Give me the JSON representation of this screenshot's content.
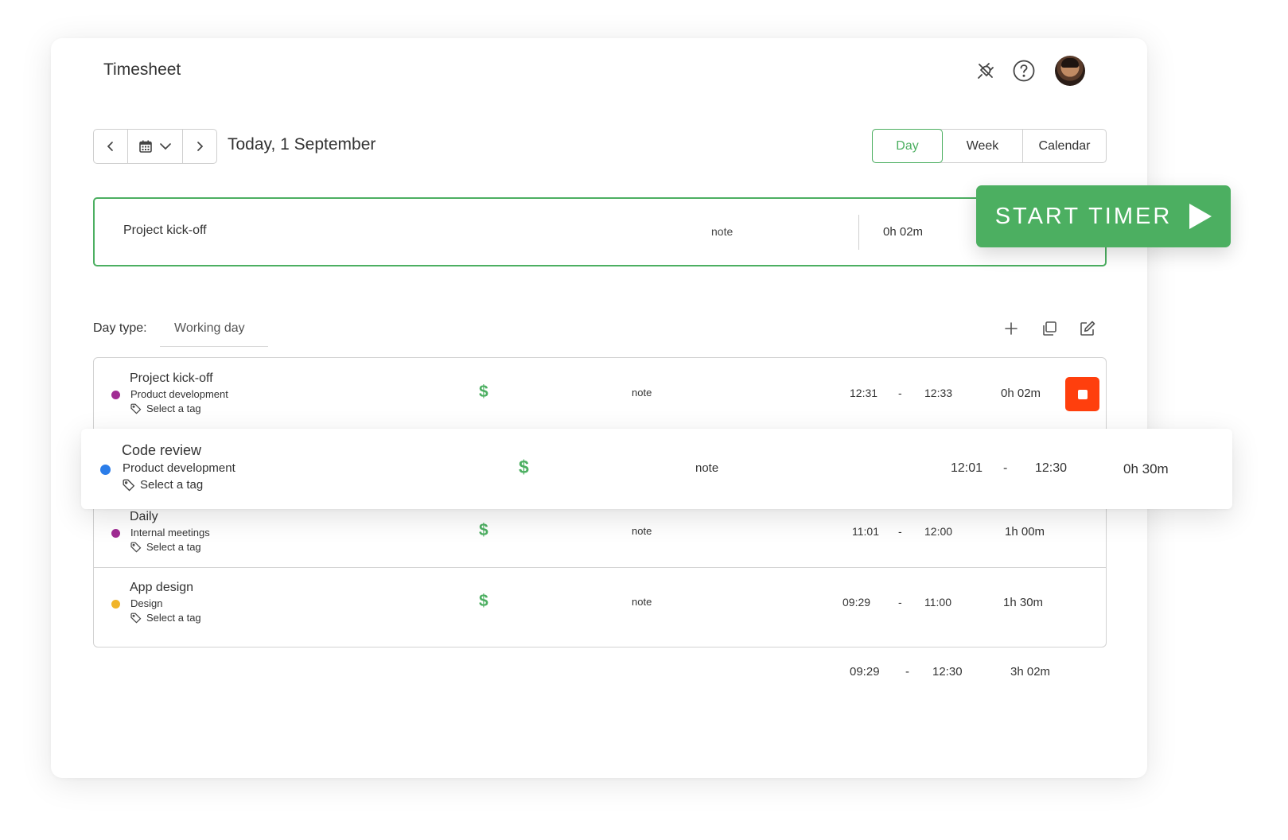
{
  "header": {
    "title": "Timesheet"
  },
  "icons": {
    "integrations": "plug-icon",
    "help": "help-circle-icon",
    "avatar": "user-avatar"
  },
  "date_nav": {
    "date_label": "Today, 1 September"
  },
  "view_tabs": {
    "day": "Day",
    "week": "Week",
    "calendar": "Calendar",
    "active": "Day"
  },
  "timer": {
    "task": "Project kick-off",
    "note": "note",
    "duration": "0h 02m",
    "start_label": "START TIMER"
  },
  "day_type": {
    "label": "Day type:",
    "value": "Working day"
  },
  "entries": [
    {
      "task": "Project kick-off",
      "project": "Product development",
      "tag": "Select a tag",
      "billable": "$",
      "note": "note",
      "start": "12:31",
      "dash": "-",
      "end": "12:33",
      "duration": "0h 02m",
      "color": "#a02b93",
      "running": true
    },
    {
      "task": "Code review",
      "project": "Product development",
      "tag": "Select a tag",
      "billable": "$",
      "note": "note",
      "start": "12:01",
      "dash": "-",
      "end": "12:30",
      "duration": "0h 30m",
      "color": "#2b7de9",
      "running": false
    },
    {
      "task": "Daily",
      "project": "Internal meetings",
      "tag": "Select a tag",
      "billable": "$",
      "note": "note",
      "start": "11:01",
      "dash": "-",
      "end": "12:00",
      "duration": "1h 00m",
      "color": "#a02b93",
      "running": false
    },
    {
      "task": "App design",
      "project": "Design",
      "tag": "Select a tag",
      "billable": "$",
      "note": "note",
      "start": "09:29",
      "dash": "-",
      "end": "11:00",
      "duration": "1h 30m",
      "color": "#f0b429",
      "running": false
    }
  ],
  "totals": {
    "start": "09:29",
    "dash": "-",
    "end": "12:30",
    "duration": "3h 02m"
  },
  "colors": {
    "accent": "#4caf61",
    "stop": "#ff3f0d"
  }
}
